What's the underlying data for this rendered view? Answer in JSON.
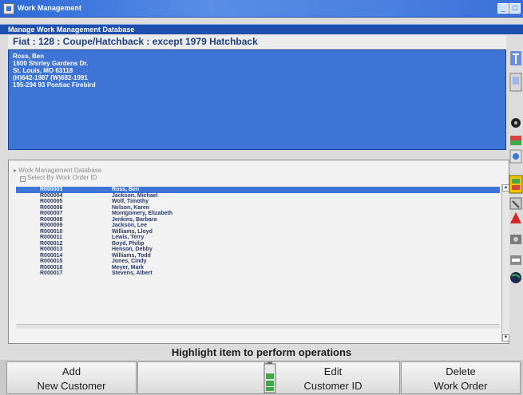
{
  "window": {
    "title": "Work Management"
  },
  "subheader": {
    "label": "Manage Work Management Database"
  },
  "vehicle": {
    "label": "Fiat : 128 : Coupe/Hatchback : except 1979 Hatchback"
  },
  "customer": {
    "lines": [
      "Ross, Ben",
      "1600 Shirley Gardens Dr.",
      "St. Louis, MO  63118",
      "(H)642-1987 (W)682-1991",
      "195-294 93 Pontiac Firebird"
    ]
  },
  "tree": {
    "root_label": "Work Management Database",
    "sub_label": "Select By Work Order ID"
  },
  "work_orders": [
    {
      "id": "R000003",
      "name": "Ross, Ben",
      "selected": true
    },
    {
      "id": "R000004",
      "name": "Jackson, Michael"
    },
    {
      "id": "R000005",
      "name": "Wolf, Timothy"
    },
    {
      "id": "R000006",
      "name": "Nelson, Karen"
    },
    {
      "id": "R000007",
      "name": "Montgomery, Elizabeth"
    },
    {
      "id": "R000008",
      "name": "Jenkins, Barbara"
    },
    {
      "id": "R000009",
      "name": "Jackson, Lee"
    },
    {
      "id": "R000010",
      "name": "Williams, Lloyd"
    },
    {
      "id": "R000011",
      "name": "Lewis, Terry"
    },
    {
      "id": "R000012",
      "name": "Boyd, Philip"
    },
    {
      "id": "R000013",
      "name": "Henson, Debby"
    },
    {
      "id": "R000014",
      "name": "Williams, Todd"
    },
    {
      "id": "R000015",
      "name": "Jones, Cindy"
    },
    {
      "id": "R000016",
      "name": "Meyer, Mark"
    },
    {
      "id": "R000017",
      "name": "Stevens, Albert"
    }
  ],
  "status": {
    "text": "Highlight item to perform operations"
  },
  "function_keys": [
    {
      "line1": "Add",
      "line2": "New Customer"
    },
    {
      "line1": "",
      "line2": ""
    },
    {
      "line1": "Edit",
      "line2": "Customer ID"
    },
    {
      "line1": "Delete",
      "line2": "Work Order"
    }
  ],
  "toolbar_icons": [
    "alignment-icon",
    "vehicle-icon",
    "tire-icon",
    "gauge-icon",
    "specs-icon",
    "person-icon",
    "tools-icon",
    "warning-icon",
    "camera-icon",
    "printer-icon",
    "globe-icon"
  ],
  "colors": {
    "accent": "#3d74d6",
    "title_bar": "#2d6ad8",
    "vehicle_text": "#1d3f80"
  }
}
